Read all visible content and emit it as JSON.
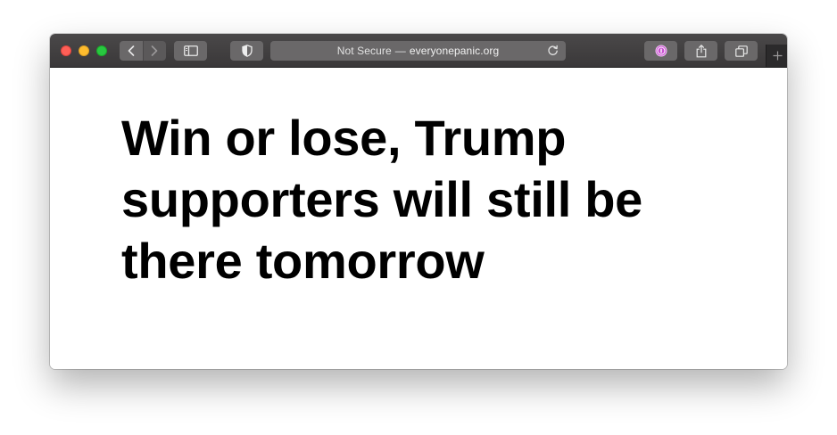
{
  "browser": {
    "address_bar": {
      "security_label": "Not Secure",
      "separator": "—",
      "domain": "everyonepanic.org"
    },
    "icons": {
      "back": "chevron-left-icon",
      "forward": "chevron-right-icon",
      "sidebar": "sidebar-icon",
      "privacy": "shield-icon",
      "reload": "reload-icon",
      "password_manager": "1password-icon",
      "share": "share-icon",
      "tabs": "tab-overview-icon",
      "new_tab": "plus-icon"
    },
    "colors": {
      "close": "#fe5f57",
      "minimize": "#febc2e",
      "maximize": "#28c840",
      "toolbar": "#3f3d3e",
      "accent_1password": "#c94fd1"
    }
  },
  "page": {
    "headline": "Win or lose, Trump supporters will still be there tomorrow"
  }
}
